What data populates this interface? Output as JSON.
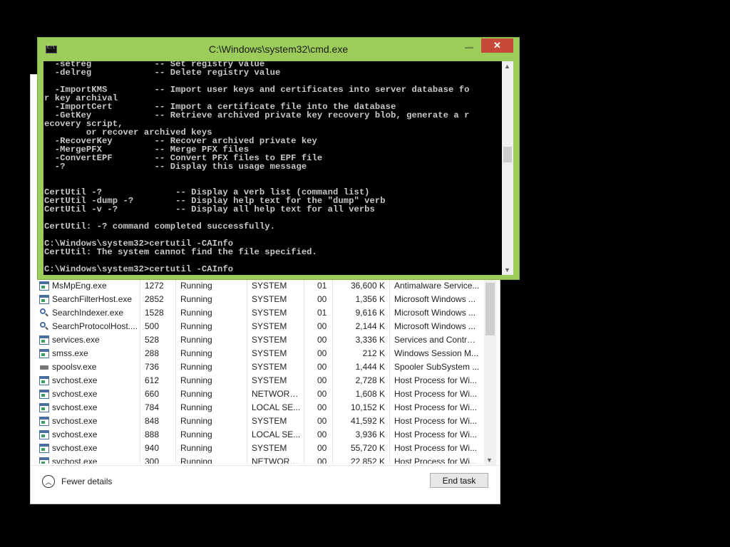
{
  "cmd_window": {
    "title": "C:\\Windows\\system32\\cmd.exe",
    "minimize_glyph": "—",
    "close_glyph": "✕",
    "console_lines": [
      "  -setreg            -- Set registry value",
      "  -delreg            -- Delete registry value",
      "",
      "  -ImportKMS         -- Import user keys and certificates into server database fo",
      "r key archival",
      "  -ImportCert        -- Import a certificate file into the database",
      "  -GetKey            -- Retrieve archived private key recovery blob, generate a r",
      "ecovery script,",
      "        or recover archived keys",
      "  -RecoverKey        -- Recover archived private key",
      "  -MergePFX          -- Merge PFX files",
      "  -ConvertEPF        -- Convert PFX files to EPF file",
      "  -?                 -- Display this usage message",
      "",
      "",
      "CertUtil -?              -- Display a verb list (command list)",
      "CertUtil -dump -?        -- Display help text for the \"dump\" verb",
      "CertUtil -v -?           -- Display all help text for all verbs",
      "",
      "CertUtil: -? command completed successfully.",
      "",
      "C:\\Windows\\system32>certutil -CAInfo",
      "CertUtil: The system cannot find the file specified.",
      "",
      "C:\\Windows\\system32>certutil -CAInfo"
    ]
  },
  "task_manager": {
    "processes": [
      {
        "icon": "app",
        "name": "MsMpEng.exe",
        "pid": "1272",
        "status": "Running",
        "user": "SYSTEM",
        "cpu": "01",
        "memory": "36,600 K",
        "description": "Antimalware Service..."
      },
      {
        "icon": "app",
        "name": "SearchFilterHost.exe",
        "pid": "2852",
        "status": "Running",
        "user": "SYSTEM",
        "cpu": "00",
        "memory": "1,356 K",
        "description": "Microsoft Windows ..."
      },
      {
        "icon": "search",
        "name": "SearchIndexer.exe",
        "pid": "1528",
        "status": "Running",
        "user": "SYSTEM",
        "cpu": "01",
        "memory": "9,616 K",
        "description": "Microsoft Windows ..."
      },
      {
        "icon": "search",
        "name": "SearchProtocolHost....",
        "pid": "500",
        "status": "Running",
        "user": "SYSTEM",
        "cpu": "00",
        "memory": "2,144 K",
        "description": "Microsoft Windows ..."
      },
      {
        "icon": "app",
        "name": "services.exe",
        "pid": "528",
        "status": "Running",
        "user": "SYSTEM",
        "cpu": "00",
        "memory": "3,336 K",
        "description": "Services and Control..."
      },
      {
        "icon": "app",
        "name": "smss.exe",
        "pid": "288",
        "status": "Running",
        "user": "SYSTEM",
        "cpu": "00",
        "memory": "212 K",
        "description": "Windows Session M..."
      },
      {
        "icon": "print",
        "name": "spoolsv.exe",
        "pid": "736",
        "status": "Running",
        "user": "SYSTEM",
        "cpu": "00",
        "memory": "1,444 K",
        "description": "Spooler SubSystem ..."
      },
      {
        "icon": "app",
        "name": "svchost.exe",
        "pid": "612",
        "status": "Running",
        "user": "SYSTEM",
        "cpu": "00",
        "memory": "2,728 K",
        "description": "Host Process for Wi..."
      },
      {
        "icon": "app",
        "name": "svchost.exe",
        "pid": "660",
        "status": "Running",
        "user": "NETWORK...",
        "cpu": "00",
        "memory": "1,608 K",
        "description": "Host Process for Wi..."
      },
      {
        "icon": "app",
        "name": "svchost.exe",
        "pid": "784",
        "status": "Running",
        "user": "LOCAL SE...",
        "cpu": "00",
        "memory": "10,152 K",
        "description": "Host Process for Wi..."
      },
      {
        "icon": "app",
        "name": "svchost.exe",
        "pid": "848",
        "status": "Running",
        "user": "SYSTEM",
        "cpu": "00",
        "memory": "41,592 K",
        "description": "Host Process for Wi..."
      },
      {
        "icon": "app",
        "name": "svchost.exe",
        "pid": "888",
        "status": "Running",
        "user": "LOCAL SE...",
        "cpu": "00",
        "memory": "3,936 K",
        "description": "Host Process for Wi..."
      },
      {
        "icon": "app",
        "name": "svchost.exe",
        "pid": "940",
        "status": "Running",
        "user": "SYSTEM",
        "cpu": "00",
        "memory": "55,720 K",
        "description": "Host Process for Wi..."
      },
      {
        "icon": "app",
        "name": "svchost.exe",
        "pid": "300",
        "status": "Running",
        "user": "NETWORK...",
        "cpu": "00",
        "memory": "22,852 K",
        "description": "Host Process for Wi..."
      }
    ],
    "fewer_details_label": "Fewer details",
    "end_task_label": "End task"
  }
}
